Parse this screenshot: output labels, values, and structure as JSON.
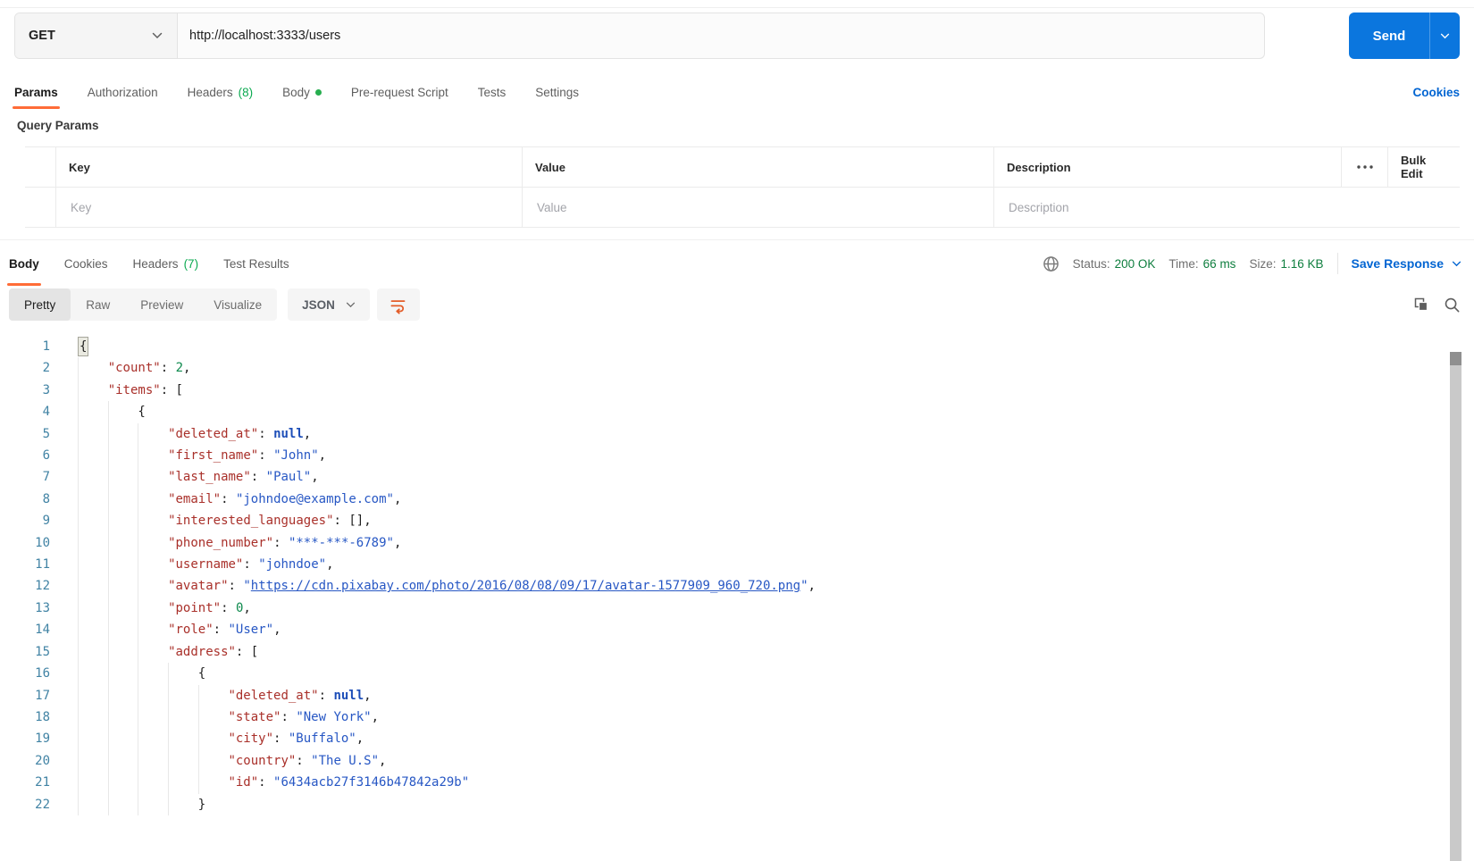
{
  "request": {
    "method": "GET",
    "url": "http://localhost:3333/users",
    "send_label": "Send",
    "cookies_link": "Cookies",
    "tabs": [
      {
        "label": "Params",
        "active": true
      },
      {
        "label": "Authorization"
      },
      {
        "label": "Headers",
        "count": "(8)"
      },
      {
        "label": "Body",
        "dot": true
      },
      {
        "label": "Pre-request Script"
      },
      {
        "label": "Tests"
      },
      {
        "label": "Settings"
      }
    ],
    "query_params": {
      "title": "Query Params",
      "columns": {
        "key": "Key",
        "value": "Value",
        "description": "Description"
      },
      "placeholders": {
        "key": "Key",
        "value": "Value",
        "description": "Description"
      },
      "bulk_edit_label": "Bulk Edit"
    }
  },
  "response": {
    "tabs": [
      {
        "label": "Body",
        "active": true
      },
      {
        "label": "Cookies"
      },
      {
        "label": "Headers",
        "count": "(7)"
      },
      {
        "label": "Test Results"
      }
    ],
    "meta": {
      "status_label": "Status:",
      "status_value": "200 OK",
      "time_label": "Time:",
      "time_value": "66 ms",
      "size_label": "Size:",
      "size_value": "1.16 KB"
    },
    "save_response_label": "Save Response",
    "viewer": {
      "modes": [
        {
          "label": "Pretty",
          "active": true
        },
        {
          "label": "Raw"
        },
        {
          "label": "Preview"
        },
        {
          "label": "Visualize"
        }
      ],
      "language": "JSON"
    }
  },
  "colors": {
    "accent_orange": "#FF6C37",
    "send_blue": "#0B76DE",
    "link_blue": "#0265D2",
    "count_green": "#0CAA51",
    "status_green": "#0E7E3E",
    "code_key": "#A9302A",
    "code_string": "#2757C4",
    "code_null": "#1D4EB8",
    "code_number": "#0F8A4E",
    "line_number": "#4183A4"
  },
  "code": {
    "lines": [
      {
        "n": 1,
        "i": 0,
        "p": [
          [
            "hl",
            "{"
          ]
        ]
      },
      {
        "n": 2,
        "i": 1,
        "p": [
          [
            "k",
            "\"count\""
          ],
          [
            "pn",
            ": "
          ],
          [
            "num",
            "2"
          ],
          [
            "pn",
            ","
          ]
        ]
      },
      {
        "n": 3,
        "i": 1,
        "p": [
          [
            "k",
            "\"items\""
          ],
          [
            "pn",
            ": ["
          ]
        ]
      },
      {
        "n": 4,
        "i": 2,
        "p": [
          [
            "pn",
            "{"
          ]
        ]
      },
      {
        "n": 5,
        "i": 3,
        "p": [
          [
            "k",
            "\"deleted_at\""
          ],
          [
            "pn",
            ": "
          ],
          [
            "nul",
            "null"
          ],
          [
            "pn",
            ","
          ]
        ]
      },
      {
        "n": 6,
        "i": 3,
        "p": [
          [
            "k",
            "\"first_name\""
          ],
          [
            "pn",
            ": "
          ],
          [
            "str",
            "\"John\""
          ],
          [
            "pn",
            ","
          ]
        ]
      },
      {
        "n": 7,
        "i": 3,
        "p": [
          [
            "k",
            "\"last_name\""
          ],
          [
            "pn",
            ": "
          ],
          [
            "str",
            "\"Paul\""
          ],
          [
            "pn",
            ","
          ]
        ]
      },
      {
        "n": 8,
        "i": 3,
        "p": [
          [
            "k",
            "\"email\""
          ],
          [
            "pn",
            ": "
          ],
          [
            "str",
            "\"johndoe@example.com\""
          ],
          [
            "pn",
            ","
          ]
        ]
      },
      {
        "n": 9,
        "i": 3,
        "p": [
          [
            "k",
            "\"interested_languages\""
          ],
          [
            "pn",
            ": [],"
          ]
        ]
      },
      {
        "n": 10,
        "i": 3,
        "p": [
          [
            "k",
            "\"phone_number\""
          ],
          [
            "pn",
            ": "
          ],
          [
            "str",
            "\"***-***-6789\""
          ],
          [
            "pn",
            ","
          ]
        ]
      },
      {
        "n": 11,
        "i": 3,
        "p": [
          [
            "k",
            "\"username\""
          ],
          [
            "pn",
            ": "
          ],
          [
            "str",
            "\"johndoe\""
          ],
          [
            "pn",
            ","
          ]
        ]
      },
      {
        "n": 12,
        "i": 3,
        "p": [
          [
            "k",
            "\"avatar\""
          ],
          [
            "pn",
            ": "
          ],
          [
            "str",
            "\""
          ],
          [
            "lnk",
            "https://cdn.pixabay.com/photo/2016/08/08/09/17/avatar-1577909_960_720.png"
          ],
          [
            "str",
            "\""
          ],
          [
            "pn",
            ","
          ]
        ]
      },
      {
        "n": 13,
        "i": 3,
        "p": [
          [
            "k",
            "\"point\""
          ],
          [
            "pn",
            ": "
          ],
          [
            "num",
            "0"
          ],
          [
            "pn",
            ","
          ]
        ]
      },
      {
        "n": 14,
        "i": 3,
        "p": [
          [
            "k",
            "\"role\""
          ],
          [
            "pn",
            ": "
          ],
          [
            "str",
            "\"User\""
          ],
          [
            "pn",
            ","
          ]
        ]
      },
      {
        "n": 15,
        "i": 3,
        "p": [
          [
            "k",
            "\"address\""
          ],
          [
            "pn",
            ": ["
          ]
        ]
      },
      {
        "n": 16,
        "i": 4,
        "p": [
          [
            "pn",
            "{"
          ]
        ]
      },
      {
        "n": 17,
        "i": 5,
        "p": [
          [
            "k",
            "\"deleted_at\""
          ],
          [
            "pn",
            ": "
          ],
          [
            "nul",
            "null"
          ],
          [
            "pn",
            ","
          ]
        ]
      },
      {
        "n": 18,
        "i": 5,
        "p": [
          [
            "k",
            "\"state\""
          ],
          [
            "pn",
            ": "
          ],
          [
            "str",
            "\"New York\""
          ],
          [
            "pn",
            ","
          ]
        ]
      },
      {
        "n": 19,
        "i": 5,
        "p": [
          [
            "k",
            "\"city\""
          ],
          [
            "pn",
            ": "
          ],
          [
            "str",
            "\"Buffalo\""
          ],
          [
            "pn",
            ","
          ]
        ]
      },
      {
        "n": 20,
        "i": 5,
        "p": [
          [
            "k",
            "\"country\""
          ],
          [
            "pn",
            ": "
          ],
          [
            "str",
            "\"The U.S\""
          ],
          [
            "pn",
            ","
          ]
        ]
      },
      {
        "n": 21,
        "i": 5,
        "p": [
          [
            "k",
            "\"id\""
          ],
          [
            "pn",
            ": "
          ],
          [
            "str",
            "\"6434acb27f3146b47842a29b\""
          ]
        ]
      },
      {
        "n": 22,
        "i": 4,
        "p": [
          [
            "pn",
            "}"
          ]
        ]
      }
    ]
  }
}
